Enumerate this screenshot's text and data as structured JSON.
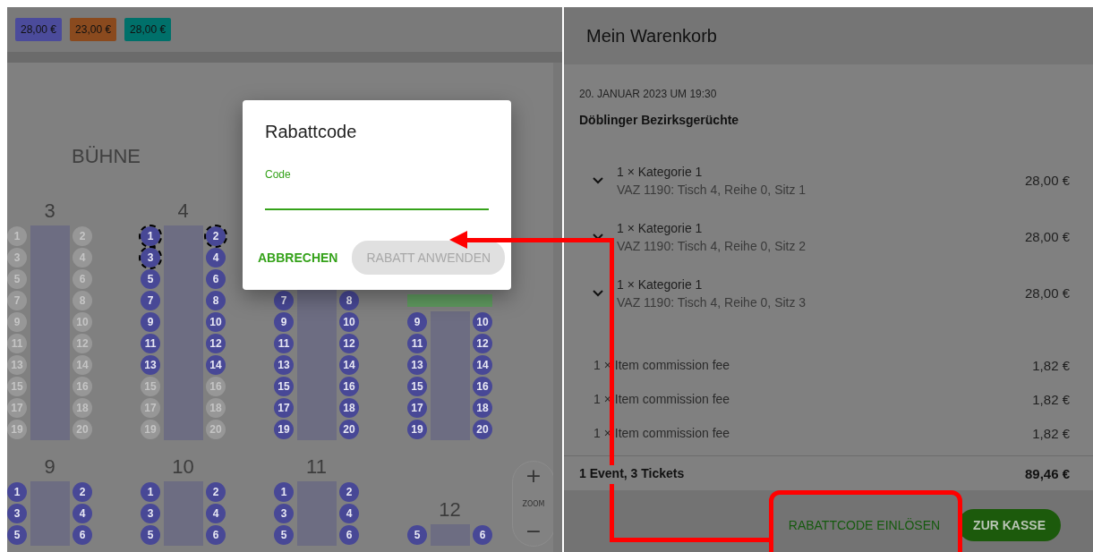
{
  "price_chips": [
    {
      "label": "28,00 €",
      "color": "#4b4b9b"
    },
    {
      "label": "23,00 €",
      "color": "#8a4a1e"
    },
    {
      "label": "28,00 €",
      "color": "#00706a"
    }
  ],
  "seat_map": {
    "stage_label": "BÜHNE",
    "tables": [
      {
        "label": "3",
        "seats": [
          {
            "n": "1",
            "taken": true,
            "selected": false
          },
          {
            "n": "2",
            "taken": true,
            "selected": false
          },
          {
            "n": "3",
            "taken": true,
            "selected": false
          },
          {
            "n": "4",
            "taken": true,
            "selected": false
          },
          {
            "n": "5",
            "taken": true,
            "selected": false
          },
          {
            "n": "6",
            "taken": true,
            "selected": false
          },
          {
            "n": "7",
            "taken": true,
            "selected": false
          },
          {
            "n": "8",
            "taken": true,
            "selected": false
          },
          {
            "n": "9",
            "taken": true,
            "selected": false
          },
          {
            "n": "10",
            "taken": true,
            "selected": false
          },
          {
            "n": "11",
            "taken": true,
            "selected": false
          },
          {
            "n": "12",
            "taken": true,
            "selected": false
          },
          {
            "n": "13",
            "taken": true,
            "selected": false
          },
          {
            "n": "14",
            "taken": true,
            "selected": false
          },
          {
            "n": "15",
            "taken": true,
            "selected": false
          },
          {
            "n": "16",
            "taken": true,
            "selected": false
          },
          {
            "n": "17",
            "taken": true,
            "selected": false
          },
          {
            "n": "18",
            "taken": true,
            "selected": false
          },
          {
            "n": "19",
            "taken": true,
            "selected": false
          },
          {
            "n": "20",
            "taken": true,
            "selected": false
          }
        ]
      },
      {
        "label": "4",
        "seats": [
          {
            "n": "1",
            "taken": false,
            "selected": true
          },
          {
            "n": "2",
            "taken": false,
            "selected": true
          },
          {
            "n": "3",
            "taken": false,
            "selected": true
          },
          {
            "n": "4",
            "taken": false,
            "selected": false
          },
          {
            "n": "5",
            "taken": false,
            "selected": false
          },
          {
            "n": "6",
            "taken": false,
            "selected": false
          },
          {
            "n": "7",
            "taken": false,
            "selected": false
          },
          {
            "n": "8",
            "taken": false,
            "selected": false
          },
          {
            "n": "9",
            "taken": false,
            "selected": false
          },
          {
            "n": "10",
            "taken": false,
            "selected": false
          },
          {
            "n": "11",
            "taken": false,
            "selected": false
          },
          {
            "n": "12",
            "taken": false,
            "selected": false
          },
          {
            "n": "13",
            "taken": false,
            "selected": false
          },
          {
            "n": "14",
            "taken": false,
            "selected": false
          },
          {
            "n": "15",
            "taken": true,
            "selected": false
          },
          {
            "n": "16",
            "taken": true,
            "selected": false
          },
          {
            "n": "17",
            "taken": true,
            "selected": false
          },
          {
            "n": "18",
            "taken": true,
            "selected": false
          },
          {
            "n": "19",
            "taken": true,
            "selected": false
          },
          {
            "n": "20",
            "taken": true,
            "selected": false
          }
        ]
      },
      {
        "seats": [
          {
            "n": "7",
            "taken": false,
            "selected": false
          },
          {
            "n": "8",
            "taken": false,
            "selected": false
          },
          {
            "n": "9",
            "taken": false,
            "selected": false
          },
          {
            "n": "10",
            "taken": false,
            "selected": false
          },
          {
            "n": "11",
            "taken": false,
            "selected": false
          },
          {
            "n": "12",
            "taken": false,
            "selected": false
          },
          {
            "n": "13",
            "taken": false,
            "selected": false
          },
          {
            "n": "14",
            "taken": false,
            "selected": false
          },
          {
            "n": "15",
            "taken": false,
            "selected": false
          },
          {
            "n": "16",
            "taken": false,
            "selected": false
          },
          {
            "n": "17",
            "taken": false,
            "selected": false
          },
          {
            "n": "18",
            "taken": false,
            "selected": false
          },
          {
            "n": "19",
            "taken": false,
            "selected": false
          },
          {
            "n": "20",
            "taken": false,
            "selected": false
          }
        ]
      },
      {
        "marked": true,
        "seats": [
          {
            "n": "9",
            "taken": false,
            "selected": false
          },
          {
            "n": "10",
            "taken": false,
            "selected": false
          },
          {
            "n": "11",
            "taken": false,
            "selected": false
          },
          {
            "n": "12",
            "taken": false,
            "selected": false
          },
          {
            "n": "13",
            "taken": false,
            "selected": false
          },
          {
            "n": "14",
            "taken": false,
            "selected": false
          },
          {
            "n": "15",
            "taken": false,
            "selected": false
          },
          {
            "n": "16",
            "taken": false,
            "selected": false
          },
          {
            "n": "17",
            "taken": false,
            "selected": false
          },
          {
            "n": "18",
            "taken": false,
            "selected": false
          },
          {
            "n": "19",
            "taken": false,
            "selected": false
          },
          {
            "n": "20",
            "taken": false,
            "selected": false
          }
        ]
      },
      {
        "label": "9",
        "seats": [
          {
            "n": "1",
            "taken": false,
            "selected": false
          },
          {
            "n": "2",
            "taken": false,
            "selected": false
          },
          {
            "n": "3",
            "taken": false,
            "selected": false
          },
          {
            "n": "4",
            "taken": false,
            "selected": false
          },
          {
            "n": "5",
            "taken": false,
            "selected": false
          },
          {
            "n": "6",
            "taken": false,
            "selected": false
          }
        ]
      },
      {
        "label": "10",
        "seats": [
          {
            "n": "1",
            "taken": false,
            "selected": false
          },
          {
            "n": "2",
            "taken": false,
            "selected": false
          },
          {
            "n": "3",
            "taken": false,
            "selected": false
          },
          {
            "n": "4",
            "taken": false,
            "selected": false
          },
          {
            "n": "5",
            "taken": false,
            "selected": false
          },
          {
            "n": "6",
            "taken": false,
            "selected": false
          }
        ]
      },
      {
        "label": "11",
        "seats": [
          {
            "n": "1",
            "taken": false,
            "selected": false
          },
          {
            "n": "2",
            "taken": false,
            "selected": false
          },
          {
            "n": "3",
            "taken": false,
            "selected": false
          },
          {
            "n": "4",
            "taken": false,
            "selected": false
          },
          {
            "n": "5",
            "taken": false,
            "selected": false
          },
          {
            "n": "6",
            "taken": false,
            "selected": false
          }
        ]
      },
      {
        "label": "12",
        "seats": [
          {
            "n": "5",
            "taken": false,
            "selected": false
          },
          {
            "n": "6",
            "taken": false,
            "selected": false
          }
        ]
      }
    ]
  },
  "zoom": {
    "zoom_in": "+",
    "label": "ZOOM",
    "zoom_out": "−"
  },
  "dialog": {
    "title": "Rabattcode",
    "field": {
      "label": "Code"
    },
    "buttons": [
      {
        "label": "ABBRECHEN",
        "disabled": false
      },
      {
        "label": "RABATT ANWENDEN",
        "disabled": true
      }
    ]
  },
  "cart": {
    "title": "Mein Warenkorb",
    "date": "20. JANUAR 2023 UM 19:30",
    "event": "Döblinger Bezirksgerüchte",
    "tickets": [
      {
        "title": "1 × Kategorie 1",
        "detail": "VAZ 1190: Tisch 4, Reihe 0, Sitz 1",
        "price": "28,00 €",
        "expanded": false
      },
      {
        "title": "1 × Kategorie 1",
        "detail": "VAZ 1190: Tisch 4, Reihe 0, Sitz 2",
        "price": "28,00 €",
        "expanded": false
      },
      {
        "title": "1 × Kategorie 1",
        "detail": "VAZ 1190: Tisch 4, Reihe 0, Sitz 3",
        "price": "28,00 €",
        "expanded": false
      }
    ],
    "fees": [
      {
        "label": "1 × Item commission fee",
        "price": "1,82 €"
      },
      {
        "label": "1 × Item commission fee",
        "price": "1,82 €"
      },
      {
        "label": "1 × Item commission fee",
        "price": "1,82 €"
      }
    ],
    "summary": {
      "label": "1 Event, 3 Tickets",
      "total": "89,46 €"
    },
    "redeem_button": "RABATTCODE EINLÖSEN",
    "checkout_button": "ZUR KASSE"
  }
}
